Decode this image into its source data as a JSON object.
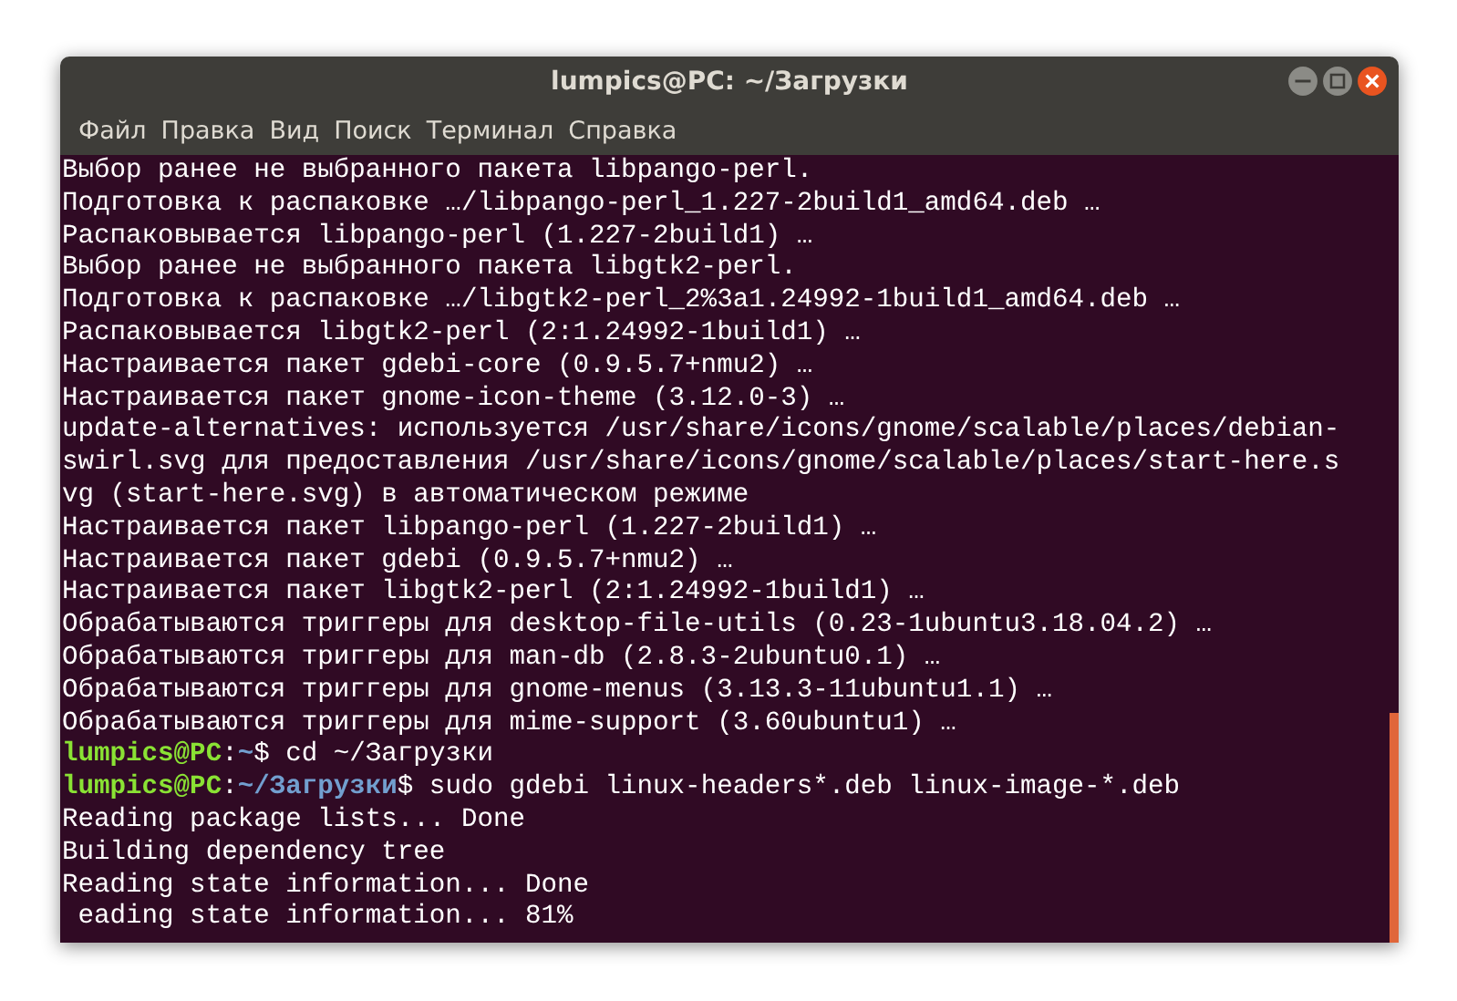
{
  "window": {
    "title": "lumpics@PC: ~/Загрузки"
  },
  "menu_bar": [
    "Файл",
    "Правка",
    "Вид",
    "Поиск",
    "Терминал",
    "Справка"
  ],
  "terminal": {
    "lines": [
      {
        "kind": "output",
        "text": "Выбор ранее не выбранного пакета libpango-perl."
      },
      {
        "kind": "output",
        "text": "Подготовка к распаковке …/libpango-perl_1.227-2build1_amd64.deb …"
      },
      {
        "kind": "output",
        "text": "Распаковывается libpango-perl (1.227-2build1) …"
      },
      {
        "kind": "output",
        "text": "Выбор ранее не выбранного пакета libgtk2-perl."
      },
      {
        "kind": "output",
        "text": "Подготовка к распаковке …/libgtk2-perl_2%3a1.24992-1build1_amd64.deb …"
      },
      {
        "kind": "output",
        "text": "Распаковывается libgtk2-perl (2:1.24992-1build1) …"
      },
      {
        "kind": "output",
        "text": "Настраивается пакет gdebi-core (0.9.5.7+nmu2) …"
      },
      {
        "kind": "output",
        "text": "Настраивается пакет gnome-icon-theme (3.12.0-3) …"
      },
      {
        "kind": "output",
        "text": "update-alternatives: используется /usr/share/icons/gnome/scalable/places/debian-"
      },
      {
        "kind": "output",
        "text": "swirl.svg для предоставления /usr/share/icons/gnome/scalable/places/start-here.s"
      },
      {
        "kind": "output",
        "text": "vg (start-here.svg) в автоматическом режиме"
      },
      {
        "kind": "output",
        "text": "Настраивается пакет libpango-perl (1.227-2build1) …"
      },
      {
        "kind": "output",
        "text": "Настраивается пакет gdebi (0.9.5.7+nmu2) …"
      },
      {
        "kind": "output",
        "text": "Настраивается пакет libgtk2-perl (2:1.24992-1build1) …"
      },
      {
        "kind": "output",
        "text": "Обрабатываются триггеры для desktop-file-utils (0.23-1ubuntu3.18.04.2) …"
      },
      {
        "kind": "output",
        "text": "Обрабатываются триггеры для man-db (2.8.3-2ubuntu0.1) …"
      },
      {
        "kind": "output",
        "text": "Обрабатываются триггеры для gnome-menus (3.13.3-11ubuntu1.1) …"
      },
      {
        "kind": "output",
        "text": "Обрабатываются триггеры для mime-support (3.60ubuntu1) …"
      },
      {
        "kind": "prompt",
        "user": "lumpics@PC",
        "sep": ":",
        "path": "~",
        "command": "$ cd ~/Загрузки"
      },
      {
        "kind": "prompt",
        "user": "lumpics@PC",
        "sep": ":",
        "path": "~/Загрузки",
        "command": "$ sudo gdebi linux-headers*.deb linux-image-*.deb"
      },
      {
        "kind": "output",
        "text": "Reading package lists... Done"
      },
      {
        "kind": "output",
        "text": "Building dependency tree"
      },
      {
        "kind": "output",
        "text": "Reading state information... Done"
      },
      {
        "kind": "output",
        "text": " eading state information... 81%"
      }
    ]
  }
}
